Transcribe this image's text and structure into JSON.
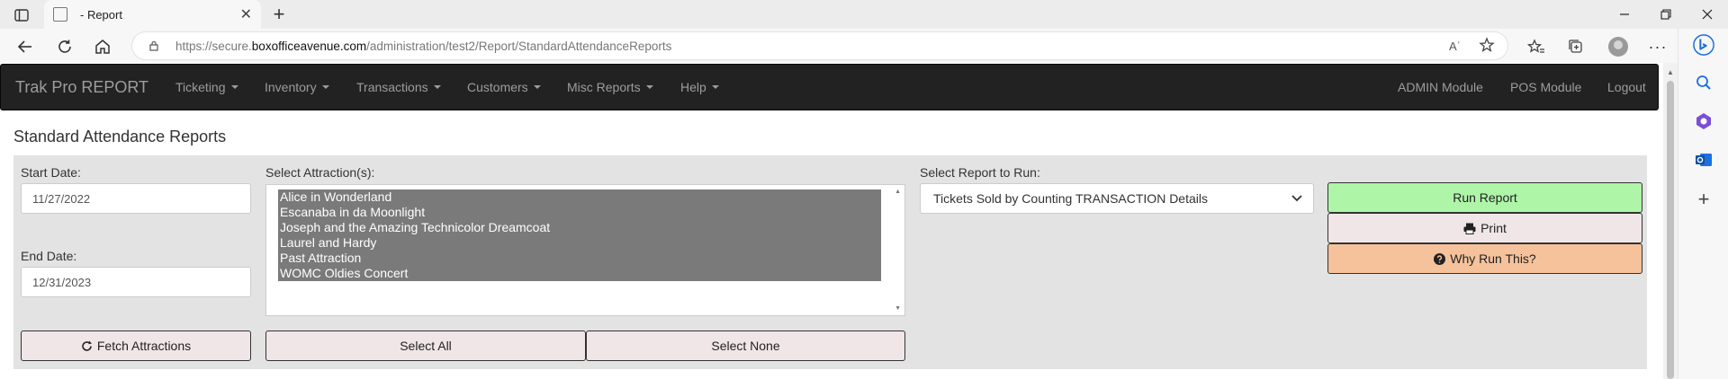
{
  "browser": {
    "tab_title": "- Report",
    "url_host_prefix": "https://secure.",
    "url_host": "boxofficeavenue.com",
    "url_path": "/administration/test2/Report/StandardAttendanceReports",
    "read_aloud_label": "Aʾ"
  },
  "nav": {
    "brand": "Trak Pro REPORT",
    "menus": [
      "Ticketing",
      "Inventory",
      "Transactions",
      "Customers",
      "Misc Reports",
      "Help"
    ],
    "right_links": [
      "ADMIN Module",
      "POS Module",
      "Logout"
    ]
  },
  "page": {
    "title": "Standard Attendance Reports",
    "start_date_label": "Start Date:",
    "start_date_value": "11/27/2022",
    "end_date_label": "End Date:",
    "end_date_value": "12/31/2023",
    "attractions_label": "Select Attraction(s):",
    "attractions": [
      "Alice in Wonderland",
      "Escanaba in da Moonlight",
      "Joseph and the Amazing Technicolor Dreamcoat",
      "Laurel and Hardy",
      "Past Attraction",
      "WOMC Oldies Concert"
    ],
    "report_label": "Select Report to Run:",
    "report_selected": "Tickets Sold by Counting TRANSACTION Details",
    "buttons": {
      "fetch": "Fetch Attractions",
      "select_all": "Select All",
      "select_none": "Select None",
      "run": "Run Report",
      "print": "Print",
      "why": "Why Run This?"
    }
  },
  "colors": {
    "run_button": "#aef5a8",
    "why_button": "#f6c29b",
    "neutral_button": "#f0e6e8",
    "navbar": "#222222",
    "panel": "#e3e3e3",
    "selected_option": "#7a7a7a"
  }
}
